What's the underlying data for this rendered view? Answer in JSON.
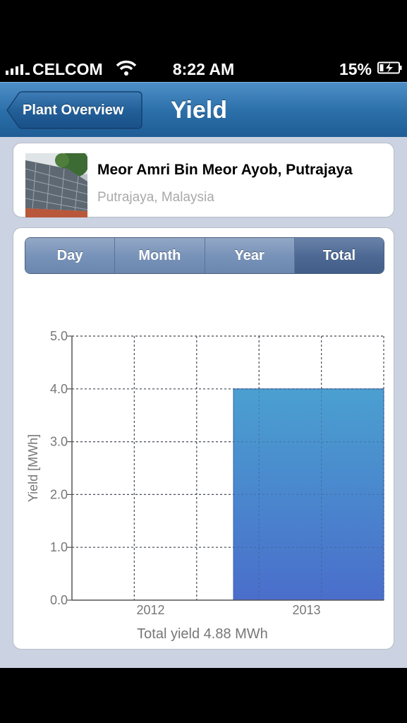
{
  "status_bar": {
    "carrier": "CELCOM",
    "time": "8:22 AM",
    "battery": "15%"
  },
  "nav": {
    "back_label": "Plant Overview",
    "title": "Yield"
  },
  "plant": {
    "name": "Meor Amri Bin Meor Ayob, Putrajaya",
    "location": "Putrajaya, Malaysia"
  },
  "tabs": [
    {
      "label": "Day",
      "selected": false
    },
    {
      "label": "Month",
      "selected": false
    },
    {
      "label": "Year",
      "selected": false
    },
    {
      "label": "Total",
      "selected": true
    }
  ],
  "chart_data": {
    "type": "bar",
    "categories": [
      "2012",
      "2013"
    ],
    "values": [
      0,
      4.0
    ],
    "ylabel": "Yield [MWh]",
    "xlabel": "Total yield 4.88 MWh",
    "ylim": [
      0,
      5.0
    ],
    "yticks": [
      "0.0",
      "1.0",
      "2.0",
      "3.0",
      "4.0",
      "5.0"
    ],
    "grid": true,
    "bar_color_top": "#4aa0d0",
    "bar_color_bottom": "#4a6ecb"
  }
}
